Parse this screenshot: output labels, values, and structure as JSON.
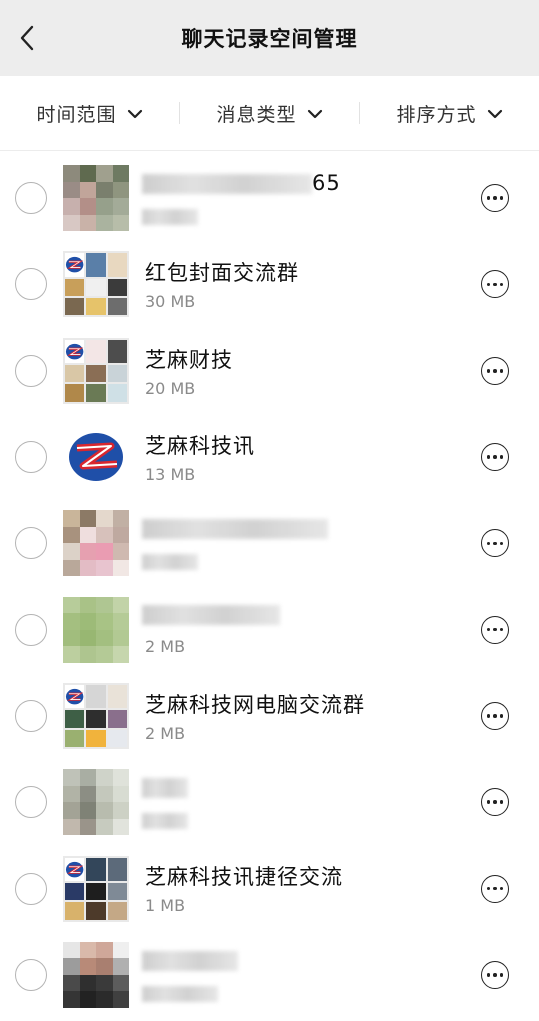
{
  "header": {
    "title": "聊天记录空间管理",
    "back_icon": "chevron-left-icon"
  },
  "filters": [
    {
      "label": "时间范围"
    },
    {
      "label": "消息类型"
    },
    {
      "label": "排序方式"
    }
  ],
  "rows": [
    {
      "name": "",
      "name_visible_suffix": "65",
      "size": "",
      "avatar": "blurred"
    },
    {
      "name": "红包封面交流群",
      "size": "30 MB",
      "avatar": "group"
    },
    {
      "name": "芝麻财技",
      "size": "20 MB",
      "avatar": "group"
    },
    {
      "name": "芝麻科技讯",
      "size": "13 MB",
      "avatar": "logo"
    },
    {
      "name": "",
      "size": "",
      "avatar": "blurred"
    },
    {
      "name": "",
      "size": "2 MB",
      "avatar": "blurred-green"
    },
    {
      "name": "芝麻科技网电脑交流群",
      "size": "2 MB",
      "avatar": "group"
    },
    {
      "name": "",
      "size": "",
      "avatar": "blurred"
    },
    {
      "name": "芝麻科技讯捷径交流",
      "size": "1 MB",
      "avatar": "group"
    },
    {
      "name": "",
      "size": "",
      "avatar": "blurred"
    }
  ],
  "colors": {
    "header_bg": "#ededed",
    "logo_blue": "#1f4fa8",
    "logo_red": "#d9262e"
  }
}
